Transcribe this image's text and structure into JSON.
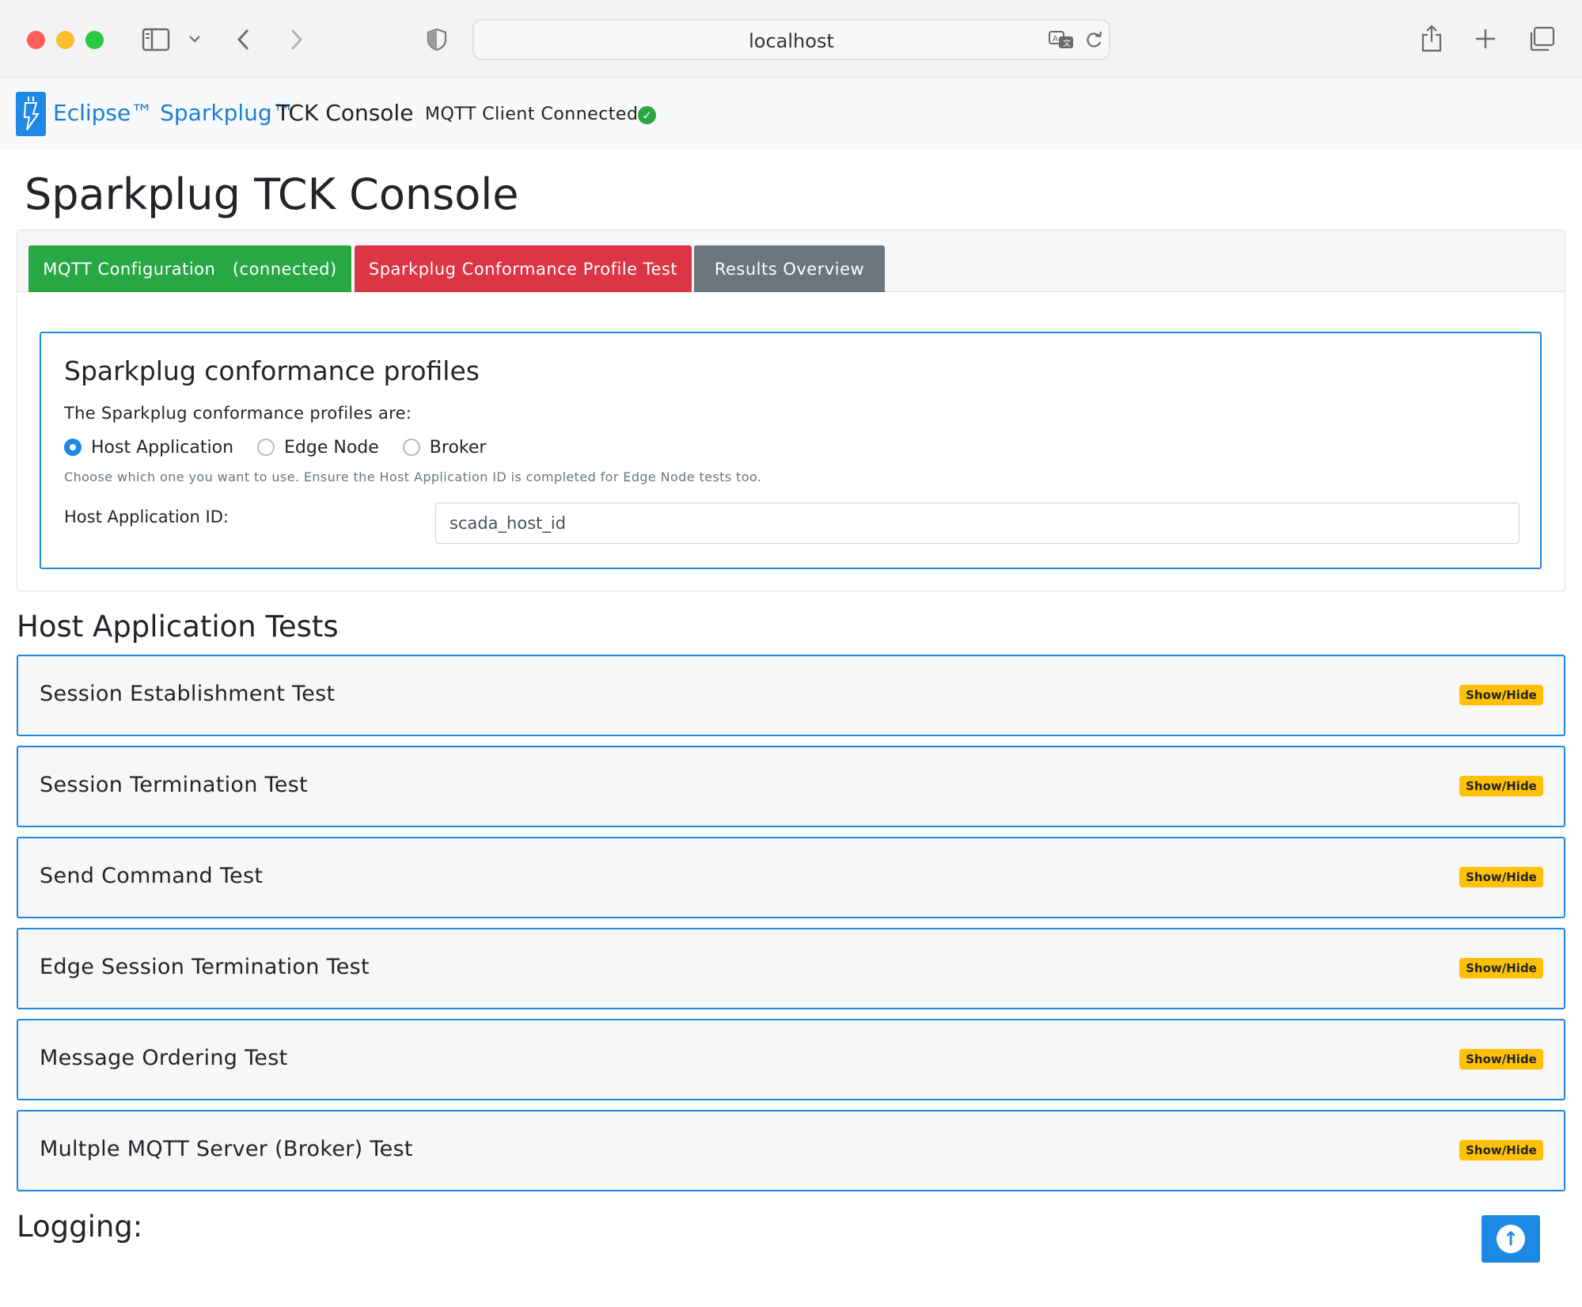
{
  "browser": {
    "url": "localhost",
    "icons": [
      "sidebar-toggle-icon",
      "chevron-down-icon",
      "back-arrow-icon",
      "forward-arrow-icon",
      "shield-icon",
      "translate-icon",
      "reload-icon",
      "share-icon",
      "new-tab-plus-icon",
      "tab-overview-icon"
    ]
  },
  "navbar": {
    "brand_blue": "Eclipse™ Sparkplug™",
    "brand_dark": "TCK Console",
    "mqtt_status": "MQTT Client Connected:"
  },
  "page": {
    "title": "Sparkplug TCK Console"
  },
  "tabs": [
    {
      "label": "MQTT Configuration   (connected)",
      "color": "#28a745"
    },
    {
      "label": "Sparkplug Conformance Profile Test",
      "color": "#dc3545"
    },
    {
      "label": "Results Overview",
      "color": "#6c757d"
    }
  ],
  "profiles": {
    "title": "Sparkplug conformance profiles",
    "subtitle": "The Sparkplug conformance profiles are:",
    "options": [
      {
        "label": "Host Application",
        "checked": true
      },
      {
        "label": "Edge Node",
        "checked": false
      },
      {
        "label": "Broker",
        "checked": false
      }
    ],
    "hint": "Choose which one you want to use. Ensure the Host Application ID is completed for Edge Node tests too.",
    "host_id_label": "Host Application ID:",
    "host_id_value": "scada_host_id"
  },
  "tests": {
    "section_title": "Host Application Tests",
    "toggle_label": "Show/Hide",
    "items": [
      "Session Establishment Test",
      "Session Termination Test",
      "Send Command Test",
      "Edge Session Termination Test",
      "Message Ordering Test",
      "Multple MQTT Server (Broker) Test"
    ]
  },
  "logging": {
    "title": "Logging:"
  },
  "colors": {
    "accent": "#1e88e5",
    "success": "#28a745",
    "danger": "#dc3545",
    "secondary": "#6c757d",
    "warning": "#ffc107"
  }
}
